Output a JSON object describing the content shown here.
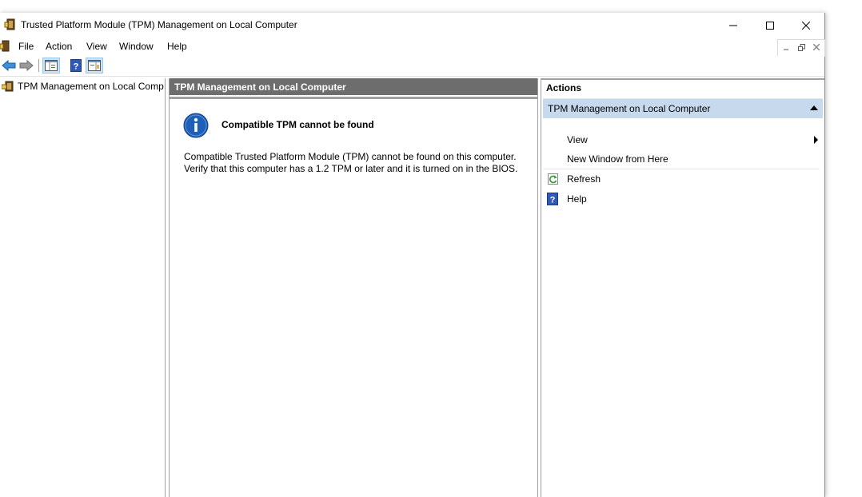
{
  "window": {
    "title": "Trusted Platform Module (TPM) Management on Local Computer"
  },
  "menu": {
    "items": [
      "File",
      "Action",
      "View",
      "Window",
      "Help"
    ]
  },
  "tree": {
    "root_label": "TPM Management on Local Comp"
  },
  "center": {
    "header": "TPM Management on Local Computer",
    "error_title": "Compatible TPM cannot be found",
    "error_body": "Compatible Trusted Platform Module (TPM) cannot be found on this computer. Verify that this computer has a 1.2 TPM or later and it is turned on in the BIOS."
  },
  "actions": {
    "header": "Actions",
    "group_label": "TPM Management on Local Computer",
    "items": [
      {
        "label": "View",
        "icon": "none",
        "has_submenu": true
      },
      {
        "label": "New Window from Here",
        "icon": "none",
        "has_submenu": false
      },
      {
        "label": "Refresh",
        "icon": "refresh-icon",
        "has_submenu": false
      },
      {
        "label": "Help",
        "icon": "help-icon",
        "has_submenu": false
      }
    ]
  },
  "colors": {
    "center_header_bg": "#6d6d6d",
    "actions_group_bg": "#c7d9ed",
    "info_icon_blue": "#1f5fb8"
  }
}
